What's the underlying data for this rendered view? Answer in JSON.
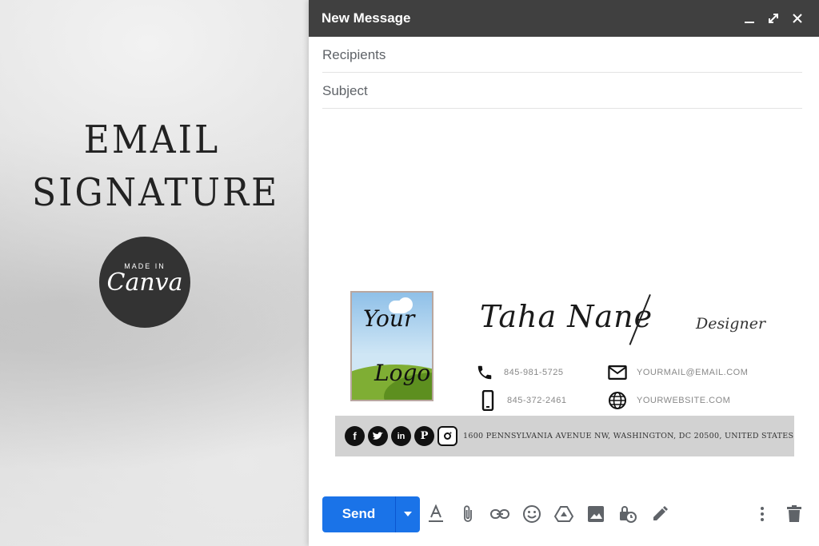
{
  "promo": {
    "title_line1": "EMAIL",
    "title_line2": "SIGNATURE",
    "badge_small": "MADE IN",
    "badge_big": "Canva"
  },
  "compose": {
    "title": "New Message",
    "window_icons": [
      "minimize-icon",
      "expand-icon",
      "close-icon"
    ],
    "recipients_placeholder": "Recipients",
    "subject_placeholder": "Subject"
  },
  "signature": {
    "logo_line1": "Your",
    "logo_line2": "Logo",
    "name": "Taha Nane",
    "role": "Designer",
    "phone": "845-981-5725",
    "mobile": "845-372-2461",
    "email": "YOURMAIL@EMAIL.COM",
    "website": "YOURWEBSITE.COM",
    "social_icons": [
      "facebook-icon",
      "twitter-icon",
      "linkedin-icon",
      "pinterest-icon",
      "instagram-icon"
    ],
    "address": "1600 PENNSYLVANIA AVENUE NW, WASHINGTON, DC 20500, UNITED STATES"
  },
  "toolbar": {
    "send_label": "Send",
    "tools": [
      "format-text-icon",
      "attach-icon",
      "link-icon",
      "emoji-icon",
      "drive-icon",
      "photo-icon",
      "confidential-icon",
      "signature-icon"
    ],
    "right_tools": [
      "more-options-icon",
      "discard-icon"
    ]
  },
  "colors": {
    "titlebar": "#404040",
    "send_button": "#1a73e8",
    "social_bar": "#d2d2d2"
  }
}
